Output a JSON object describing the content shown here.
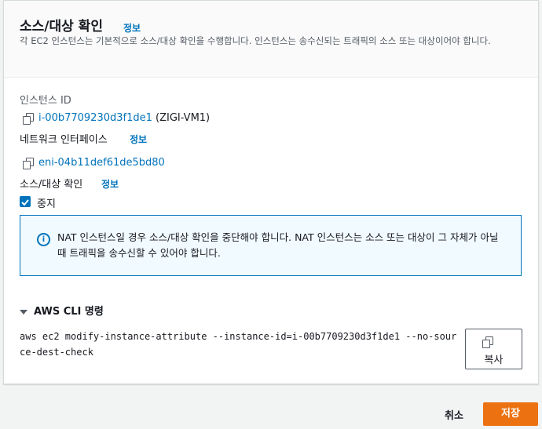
{
  "header": {
    "title": "소스/대상 확인",
    "info_link": "정보",
    "description": "각 EC2 인스턴스는 기본적으로 소스/대상 확인을 수행합니다. 인스턴스는 송수신되는 트래픽의 소스 또는 대상이어야 합니다."
  },
  "instance": {
    "label": "인스턴스 ID",
    "id": "i-00b7709230d3f1de1",
    "name": "(ZIGI-VM1)"
  },
  "network_interface": {
    "label": "네트워크 인터페이스",
    "info_link": "정보",
    "id": "eni-04b11def61de5bd80"
  },
  "source_dest_check": {
    "label": "소스/대상 확인",
    "info_link": "정보",
    "checkbox_label": "중지",
    "checked": true
  },
  "alert": {
    "icon": "info-circle-icon",
    "text": "NAT 인스턴스일 경우 소스/대상 확인을 중단해야 합니다. NAT 인스턴스는 소스 또는 대상이 그 자체가 아닐 때 트래픽을 송수신할 수 있어야 합니다."
  },
  "cli": {
    "toggle_label": "AWS CLI 명령",
    "command": "aws ec2 modify-instance-attribute --instance-id=i-00b7709230d3f1de1 --no-source-dest-check",
    "copy_label": "복사"
  },
  "footer": {
    "cancel_label": "취소",
    "save_label": "저장"
  },
  "colors": {
    "link": "#0073bb",
    "primary": "#ec7211",
    "alert_bg": "#f1faff"
  }
}
